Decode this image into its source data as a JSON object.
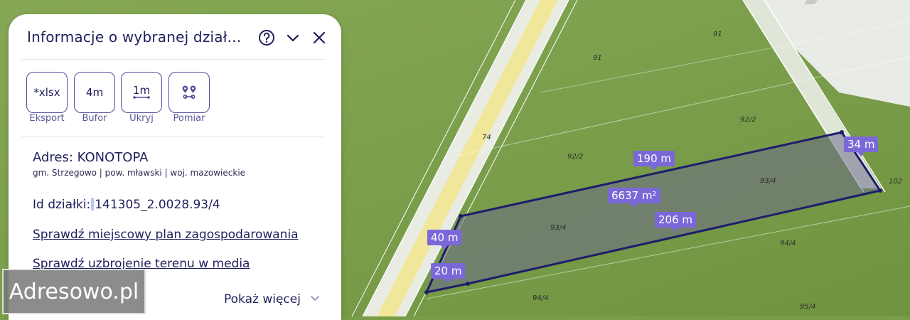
{
  "panel": {
    "title": "Informacje o wybranej dział...",
    "tools": [
      {
        "value": "*xlsx",
        "label": "Eksport",
        "icon": "export-icon"
      },
      {
        "value": "4m",
        "label": "Bufor",
        "icon": "buffer-icon"
      },
      {
        "value": "1m",
        "label": "Ukryj",
        "icon": "hide-icon"
      },
      {
        "value": "",
        "label": "Pomiar",
        "icon": "measure-pins-icon"
      }
    ],
    "address": "Adres: KONOTOPA",
    "address_details": "gm. Strzegowo | pow. mławski | woj. mazowieckie",
    "parcel_id_label": "Id działki:",
    "parcel_id_value": "141305_2.0028.93/4",
    "link_plan": "Sprawdź miejscowy plan zagospodarowania",
    "link_media": "Sprawdź uzbrojenie terenu w media",
    "show_more": "Pokaż więcej"
  },
  "map": {
    "plot_labels": [
      "91",
      "91",
      "74",
      "92/2",
      "92/2",
      "93/4",
      "93/4",
      "94/4",
      "94/4",
      "95/4",
      "102"
    ],
    "dimensions": {
      "top_edge": "190 m",
      "area": "6637 m²",
      "bottom_edge": "206 m",
      "left_edge": "40 m",
      "left_short": "20 m",
      "right_edge": "34 m"
    },
    "colors": {
      "field": "#7a9d4a",
      "road": "#f1e79a",
      "parcel_outline": "#1d1d6b",
      "dimension_bg": "#7b68d8"
    }
  },
  "watermark": "Adresowo.pl"
}
